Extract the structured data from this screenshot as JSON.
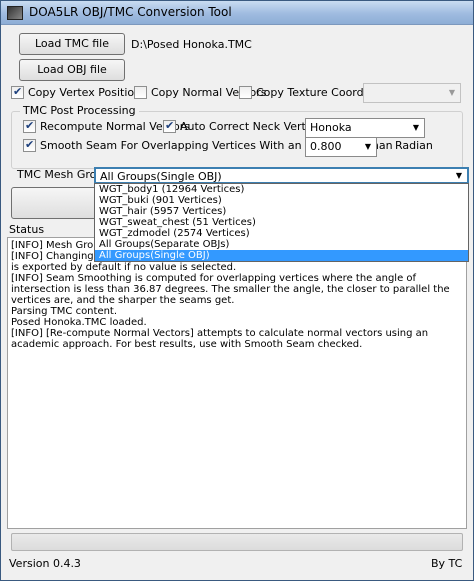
{
  "window": {
    "title": "DOA5LR OBJ/TMC Conversion Tool"
  },
  "files": {
    "load_tmc_label": "Load TMC file",
    "tmc_path": "D:\\Posed Honoka.TMC",
    "load_obj_label": "Load OBJ file",
    "obj_path": ""
  },
  "copy_options": [
    {
      "label": "Copy Vertex Positions",
      "checked": true
    },
    {
      "label": "Copy Normal Vectors",
      "checked": false
    },
    {
      "label": "Copy Texture Coordinates",
      "checked": false
    }
  ],
  "post_processing": {
    "title": "TMC Post Processing",
    "recompute_label": "Recompute Normal Vectors",
    "recompute_checked": true,
    "neck_label": "Auto Correct Neck Vertices For",
    "neck_checked": true,
    "neck_value": "Honoka",
    "smooth_label": "Smooth Seam For Overlapping Vertices With an Angle Less than",
    "smooth_checked": true,
    "angle_value": "0.800",
    "angle_unit": "Radian"
  },
  "mesh_group": {
    "label": "TMC Mesh Group",
    "selected": "All Groups(Single OBJ)",
    "options": [
      "WGT_body1 (12964 Vertices)",
      "WGT_buki (901 Vertices)",
      "WGT_hair (5957 Vertices)",
      "WGT_sweat_chest (51 Vertices)",
      "WGT_zdmodel (2574 Vertices)",
      "All Groups(Separate OBJs)",
      "All Groups(Single OBJ)"
    ],
    "selected_index": 6
  },
  "status": {
    "label": "Status",
    "lines": [
      "[INFO] Mesh Group [",
      "[INFO] Changing [Co",
      "is exported by default if no value is selected.",
      "[INFO] Seam Smoothing is computed for overlapping vertices where the angle of intersection is less than 36.87 degrees.  The smaller the angle, the closer to parallel the vertices are, and the sharper the seams get.",
      "Parsing TMC content.",
      "Posed Honoka.TMC loaded.",
      "[INFO] [Re-compute Normal Vectors] attempts to calculate normal vectors using an academic approach. For best results, use with Smooth Seam checked."
    ]
  },
  "progress": {
    "value": 0
  },
  "footer": {
    "version": "Version 0.4.3",
    "author": "By TC"
  }
}
